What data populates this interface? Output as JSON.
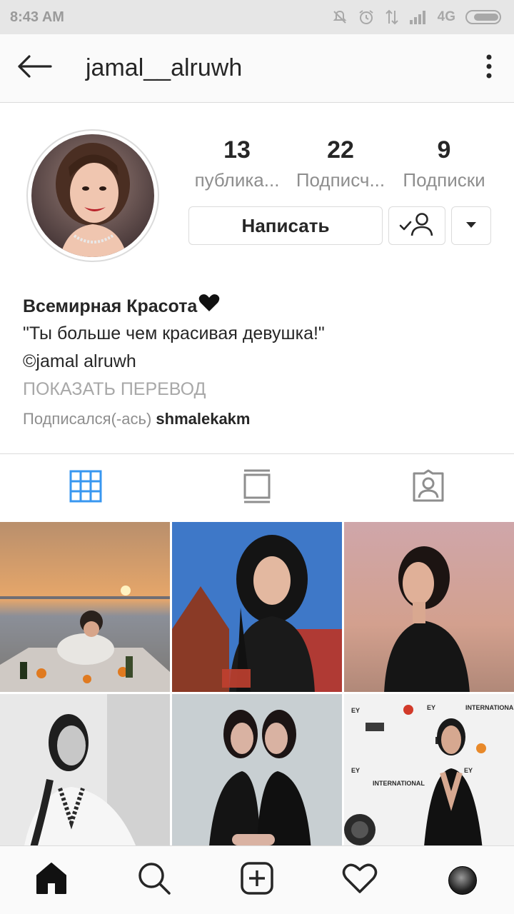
{
  "status_bar": {
    "time": "8:43 AM",
    "network": "4G",
    "icons": [
      "mute-icon",
      "alarm-icon",
      "data-transfer-icon",
      "signal-icon",
      "battery-icon"
    ]
  },
  "header": {
    "username": "jamal__alruwh",
    "back_icon": "arrow-left-icon",
    "more_icon": "more-vertical-icon"
  },
  "profile": {
    "stats": [
      {
        "value": "13",
        "label": "публика..."
      },
      {
        "value": "22",
        "label": "Подписч..."
      },
      {
        "value": "9",
        "label": "Подписки"
      }
    ],
    "message_button": "Написать",
    "follow_icon": "user-check-icon",
    "dropdown_icon": "caret-down-icon"
  },
  "bio": {
    "name": "Всемирная Красота",
    "name_icon": "black-heart-icon",
    "line1": "\"Ты больше чем красивая девушка!\"",
    "line2": "©jamal alruwh",
    "translate": "ПОКАЗАТЬ ПЕРЕВОД",
    "followed_prefix": "Подписался(-ась)",
    "followed_user": "shmalekakm"
  },
  "tabs": [
    {
      "icon": "grid-icon",
      "active": true
    },
    {
      "icon": "feed-icon",
      "active": false
    },
    {
      "icon": "tagged-icon",
      "active": false
    }
  ],
  "colors": {
    "accent": "#3897f0",
    "icon_gray": "#8e8e8e",
    "text": "#262626",
    "secondary_text": "#8e8e8e",
    "border": "#dbdbdb"
  },
  "bottom_nav": [
    "home-icon",
    "search-icon",
    "add-post-icon",
    "activity-heart-icon",
    "profile-avatar"
  ]
}
